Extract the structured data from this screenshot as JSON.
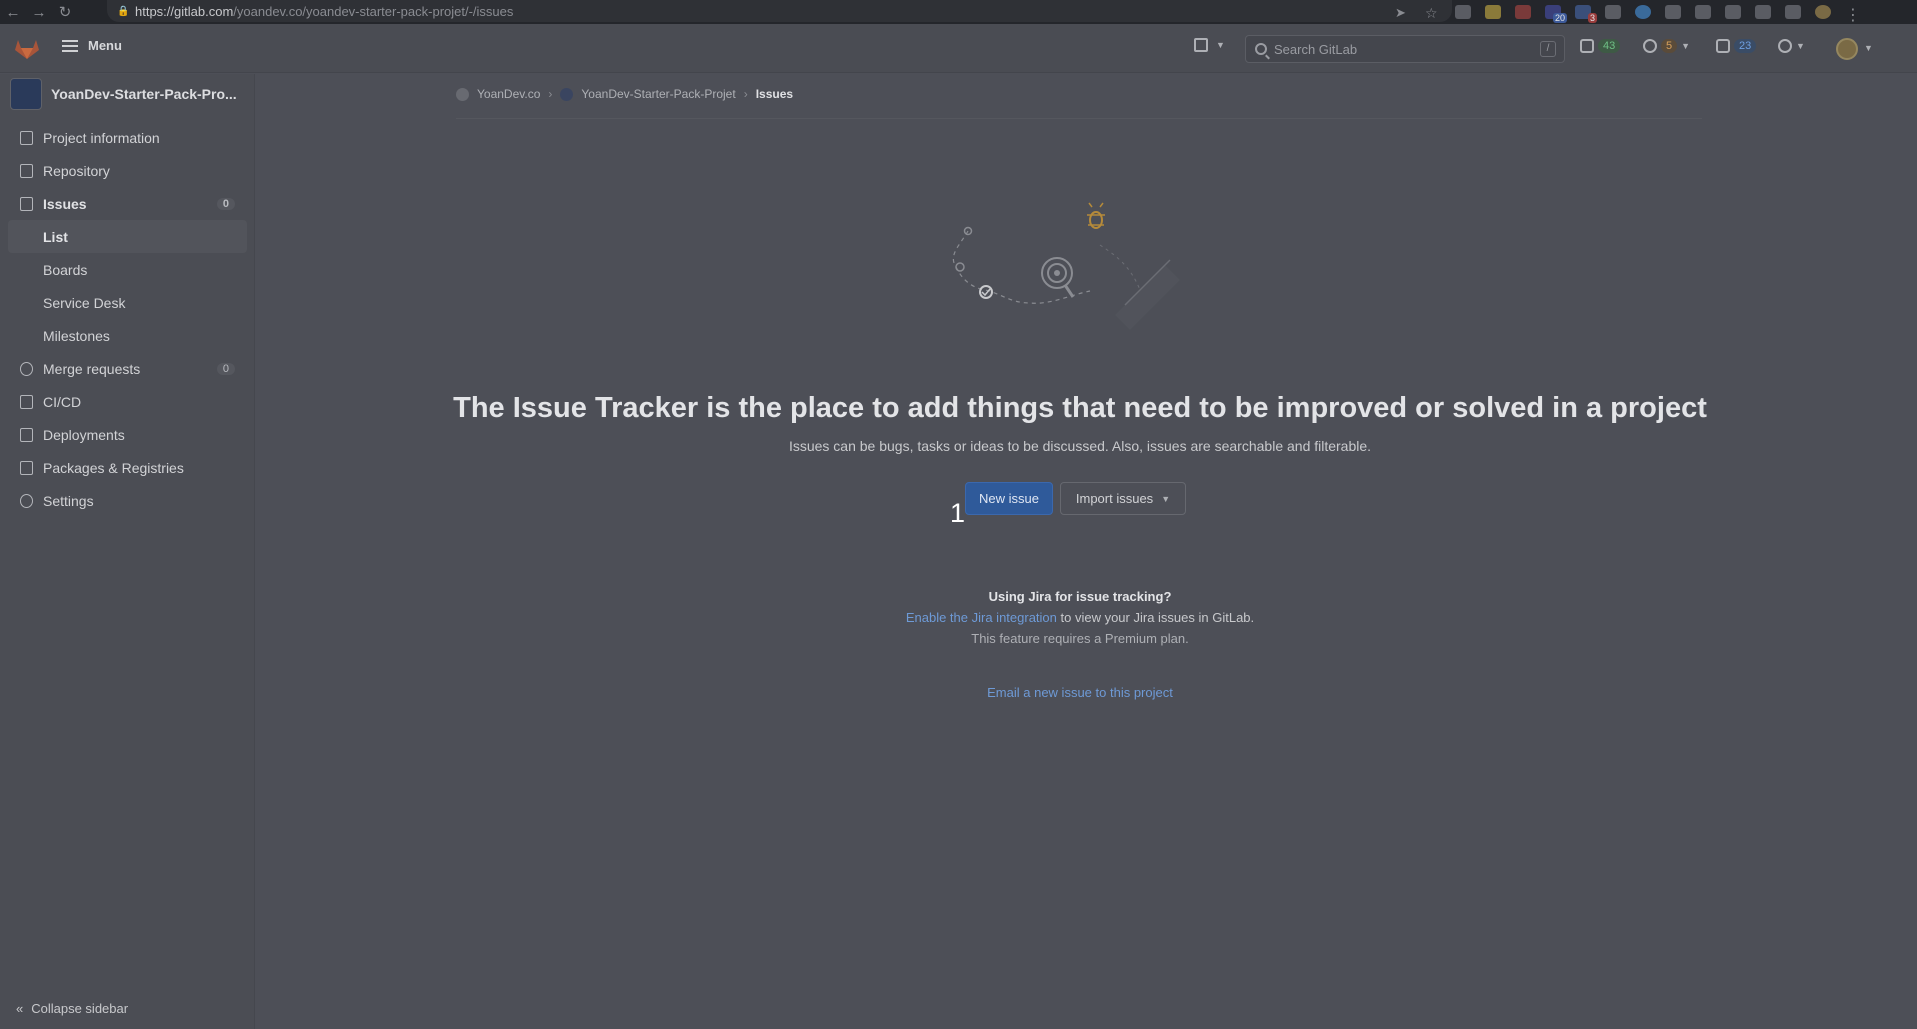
{
  "browser": {
    "url_host": "https://gitlab.com",
    "url_path": "/yoandev.co/yoandev-starter-pack-projet/-/issues",
    "extension_badges": [
      "20",
      "3"
    ]
  },
  "header": {
    "menu_label": "Menu",
    "search_placeholder": "Search GitLab",
    "search_shortcut": "/",
    "issues_count": "43",
    "merge_requests_count": "5",
    "todos_count": "23"
  },
  "sidebar": {
    "project_name": "YoanDev-Starter-Pack-Pro...",
    "items": [
      {
        "label": "Project information",
        "icon": "info-icon"
      },
      {
        "label": "Repository",
        "icon": "doc-icon"
      },
      {
        "label": "Issues",
        "icon": "issues-icon",
        "count": "0"
      },
      {
        "label": "List"
      },
      {
        "label": "Boards"
      },
      {
        "label": "Service Desk"
      },
      {
        "label": "Milestones"
      },
      {
        "label": "Merge requests",
        "icon": "merge-icon",
        "count": "0"
      },
      {
        "label": "CI/CD",
        "icon": "rocket-icon"
      },
      {
        "label": "Deployments",
        "icon": "deploy-icon"
      },
      {
        "label": "Packages & Registries",
        "icon": "package-icon"
      },
      {
        "label": "Settings",
        "icon": "gear-icon"
      }
    ],
    "collapse_label": "Collapse sidebar"
  },
  "breadcrumb": [
    "YoanDev.co",
    "YoanDev-Starter-Pack-Projet",
    "Issues"
  ],
  "empty_state": {
    "title": "The Issue Tracker is the place to add things that need to be improved or solved in a project",
    "description": "Issues can be bugs, tasks or ideas to be discussed. Also, issues are searchable and filterable.",
    "new_issue_label": "New issue",
    "import_label": "Import issues",
    "step_marker": "1"
  },
  "jira": {
    "title": "Using Jira for issue tracking?",
    "link_text": "Enable the Jira integration",
    "after_link": " to view your Jira issues in GitLab.",
    "note": "This feature requires a Premium plan."
  },
  "email_link": "Email a new issue to this project",
  "colors": {
    "primary_button": "#2f5a9a",
    "link": "#6e9ad6",
    "overlay_bg": "#4d4f57"
  }
}
